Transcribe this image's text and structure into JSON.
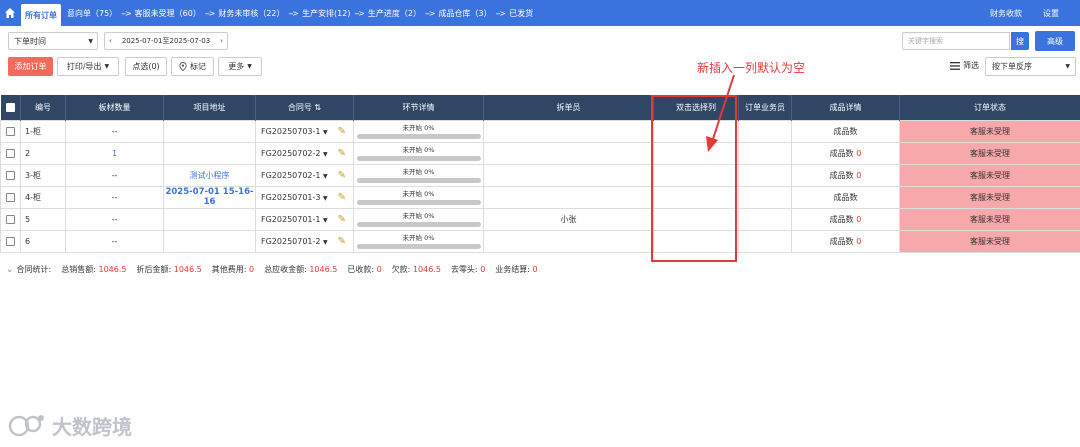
{
  "topbar": {
    "active_tab": "所有订单",
    "flow": [
      "意向单（75）",
      "客服未受理（60）",
      "财务未审核（22）",
      "生产安排(12)",
      "生产进度（2）",
      "成品仓库（3）",
      "已发货"
    ],
    "flow_arrow": "-->",
    "right": [
      "财务收款",
      "设置"
    ]
  },
  "filters": {
    "time_type": "下单时间",
    "date_range": "2025-07-01至2025-07-03",
    "keyword_placeholder": "关键字搜索",
    "search_label": "搜",
    "advanced_label": "高级"
  },
  "toolbar": {
    "add_order": "添加订单",
    "print_export": "打印/导出",
    "select": "点选(0)",
    "mark": "标记",
    "more": "更多",
    "filter": "筛选",
    "sort": "按下单反序"
  },
  "annotation": "新插入一列默认为空",
  "table": {
    "headers": [
      "编号",
      "板材数量",
      "项目地址",
      "合同号",
      "环节详情",
      "拆单员",
      "双击选择列",
      "订单业务员",
      "成品详情",
      "订单状态"
    ],
    "progress_label": "未开始 0%",
    "rows": [
      {
        "id": "1-柜",
        "qty": "--",
        "addr": "",
        "contract": "FG20250703-1",
        "splitter": "",
        "pick": "",
        "sales": "",
        "product": "成品数",
        "product_count": "",
        "status": "客服未受理"
      },
      {
        "id": "2",
        "qty": "1",
        "addr": "",
        "contract": "FG20250702-2",
        "splitter": "",
        "pick": "",
        "sales": "",
        "product": "成品数",
        "product_count": "0",
        "status": "客服未受理"
      },
      {
        "id": "3-柜",
        "qty": "--",
        "addr": "测试小程序",
        "contract": "FG20250702-1",
        "splitter": "",
        "pick": "",
        "sales": "",
        "product": "成品数",
        "product_count": "0",
        "status": "客服未受理"
      },
      {
        "id": "4-柜",
        "qty": "--",
        "addr": "2025-07-01 15-16-16",
        "contract": "FG20250701-3",
        "splitter": "",
        "pick": "",
        "sales": "",
        "product": "成品数",
        "product_count": "",
        "status": "客服未受理"
      },
      {
        "id": "5",
        "qty": "--",
        "addr": "",
        "contract": "FG20250701-1",
        "splitter": "小张",
        "pick": "",
        "sales": "",
        "product": "成品数",
        "product_count": "0",
        "status": "客服未受理"
      },
      {
        "id": "6",
        "qty": "--",
        "addr": "",
        "contract": "FG20250701-2",
        "splitter": "",
        "pick": "",
        "sales": "",
        "product": "成品数",
        "product_count": "0",
        "status": "客服未受理"
      }
    ]
  },
  "stats": {
    "label": "合同统计:",
    "items": [
      {
        "k": "总销售额:",
        "v": "1046.5"
      },
      {
        "k": "折后金额:",
        "v": "1046.5"
      },
      {
        "k": "其他费用:",
        "v": "0"
      },
      {
        "k": "总应收金额:",
        "v": "1046.5"
      },
      {
        "k": "已收款:",
        "v": "0"
      },
      {
        "k": "欠款:",
        "v": "1046.5"
      },
      {
        "k": "去零头:",
        "v": "0"
      },
      {
        "k": "业务结算:",
        "v": "0"
      }
    ]
  },
  "watermark": "大数跨境",
  "colors": {
    "primary": "#3a73dd",
    "header": "#2f4665",
    "add": "#f06b5b",
    "status": "#f7a8aa",
    "annotation": "#e53935"
  }
}
